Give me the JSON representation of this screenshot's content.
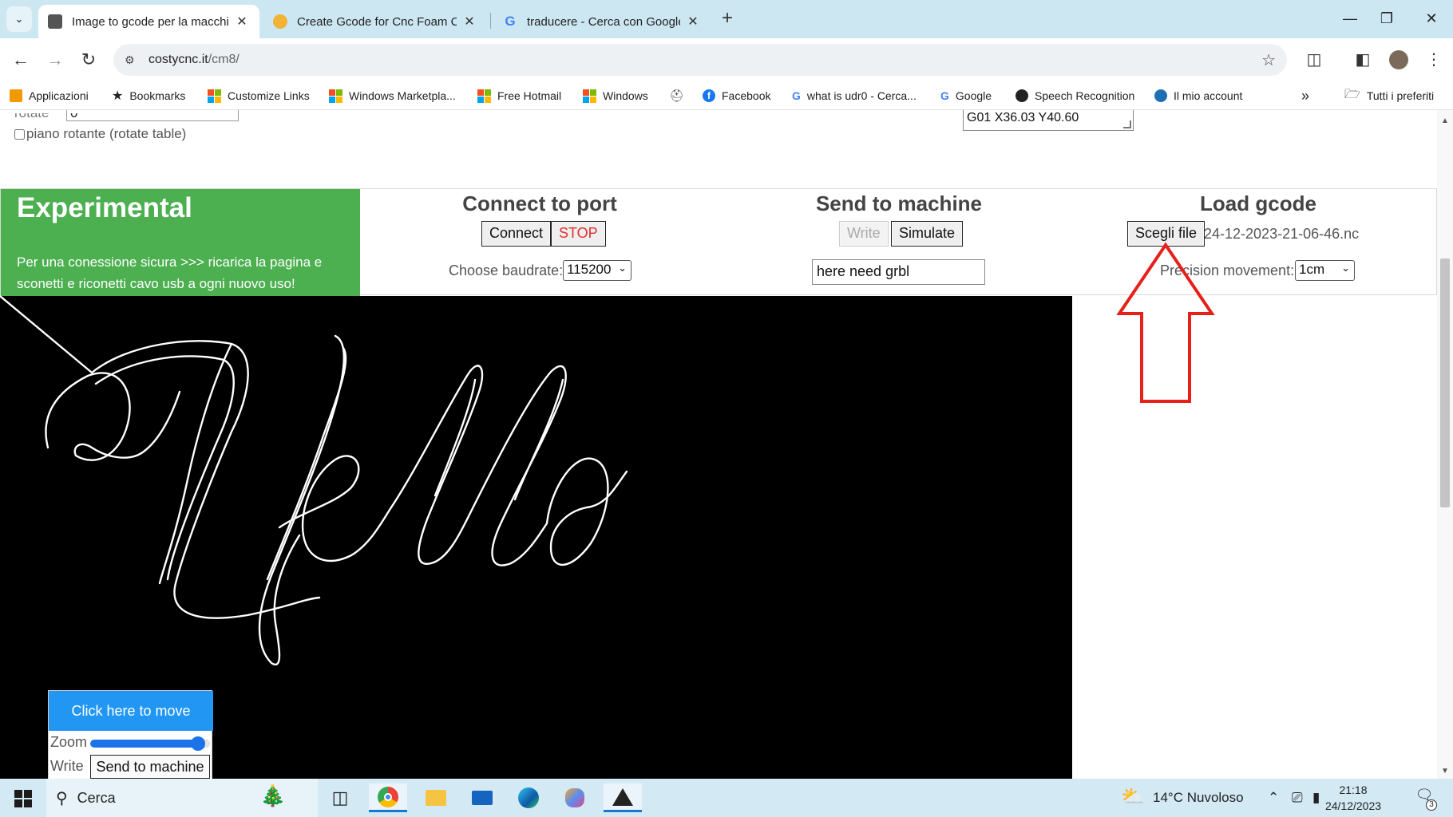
{
  "browser": {
    "tabs": [
      {
        "title": "Image to gcode per la macchina",
        "active": true
      },
      {
        "title": "Create Gcode for Cnc Foam Cut",
        "active": false
      },
      {
        "title": "traducere - Cerca con Google",
        "active": false
      }
    ],
    "url_host": "costycnc.it",
    "url_path": "/cm8/",
    "bookmarks": [
      "Applicazioni",
      "Bookmarks",
      "Customize Links",
      "Windows Marketpla...",
      "Free Hotmail",
      "Windows",
      "Facebook",
      "what is udr0 - Cerca...",
      "Google",
      "Speech Recognition",
      "Il mio account"
    ],
    "more_bookmarks": "»",
    "all_favorites": "Tutti i preferiti"
  },
  "page": {
    "rotate_label": "rotate",
    "rotate_value": "0",
    "rotate_table_label": "piano rotante (rotate table)",
    "gcode_value": "G01 X36.03 Y40.60",
    "experimental": {
      "title": "Experimental",
      "text": "Per una conessione sicura >>> ricarica la pagina e sconetti e riconetti cavo usb a ogni nuovo uso!",
      "bg_color": "#4caf50"
    },
    "connect": {
      "heading": "Connect to port",
      "connect_label": "Connect",
      "stop_label": "STOP",
      "baud_label": "Choose baudrate:",
      "baud_value": "115200"
    },
    "send": {
      "heading": "Send to machine",
      "write_label": "Write",
      "simulate_label": "Simulate",
      "status_value": "here need grbl"
    },
    "load": {
      "heading": "Load gcode",
      "choose_label": "Scegli file",
      "file_name": "24-12-2023-21-06-46.nc",
      "precision_label": "Precision movement:",
      "precision_value": "1cm"
    },
    "canvas": {
      "drawing_text": "Hello",
      "move_label": "Click here to move",
      "zoom_label": "Zoom",
      "zoom_level": 0.92,
      "write_label": "Write",
      "send_label": "Send to machine",
      "accent": "#2196f3"
    }
  },
  "taskbar": {
    "search_placeholder": "Cerca",
    "weather": "14°C  Nuvoloso",
    "time": "21:18",
    "date": "24/12/2023",
    "notifications": "3"
  }
}
